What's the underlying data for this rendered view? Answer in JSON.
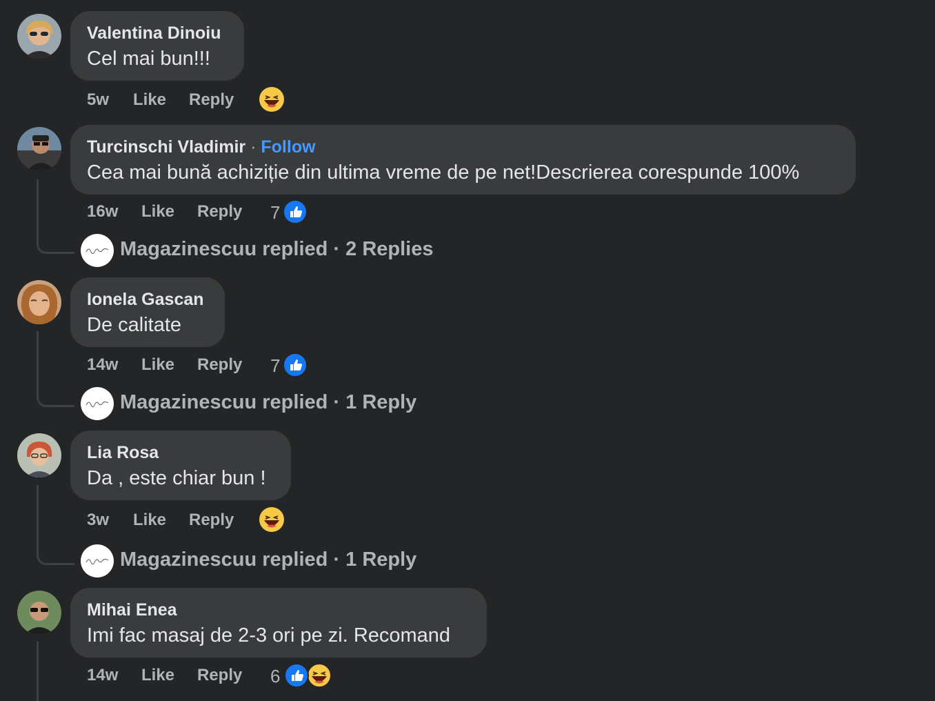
{
  "comments": [
    {
      "author": "Valentina Dinoiu",
      "text": "Cel mai bun!!!",
      "time": "5w",
      "like": "Like",
      "reply": "Reply",
      "reaction_count": "",
      "reactions": [
        "haha-emoji"
      ]
    },
    {
      "author": "Turcinschi Vladimir",
      "follow": "Follow",
      "separator": "·",
      "text": "Cea mai bună achiziție din ultima vreme de pe net!Descrierea corespunde 100%",
      "time": "16w",
      "like": "Like",
      "reply": "Reply",
      "reaction_count": "7",
      "reactions": [
        "like-reaction"
      ],
      "replies": {
        "name": "Magazinescuu replied",
        "sep": "·",
        "count": "2 Replies"
      }
    },
    {
      "author": "Ionela Gascan",
      "text": "De calitate",
      "time": "14w",
      "like": "Like",
      "reply": "Reply",
      "reaction_count": "7",
      "reactions": [
        "like-reaction"
      ],
      "replies": {
        "name": "Magazinescuu replied",
        "sep": "·",
        "count": "1 Reply"
      }
    },
    {
      "author": "Lia Rosa",
      "text": "Da , este chiar bun !",
      "time": "3w",
      "like": "Like",
      "reply": "Reply",
      "reaction_count": "",
      "reactions": [
        "haha-emoji"
      ],
      "replies": {
        "name": "Magazinescuu replied",
        "sep": "·",
        "count": "1 Reply"
      }
    },
    {
      "author": "Mihai Enea",
      "text": "Imi fac masaj de 2-3 ori pe zi. Recomand",
      "time": "14w",
      "like": "Like",
      "reply": "Reply",
      "reaction_count": "6",
      "reactions": [
        "like-reaction",
        "haha-emoji"
      ]
    }
  ],
  "colors": {
    "background": "#242526",
    "bubble": "#3a3b3c",
    "primary_text": "#e4e6eb",
    "secondary_text": "#b0b3b8",
    "follow_link": "#4599ff",
    "like_blue": "#1877f2"
  }
}
